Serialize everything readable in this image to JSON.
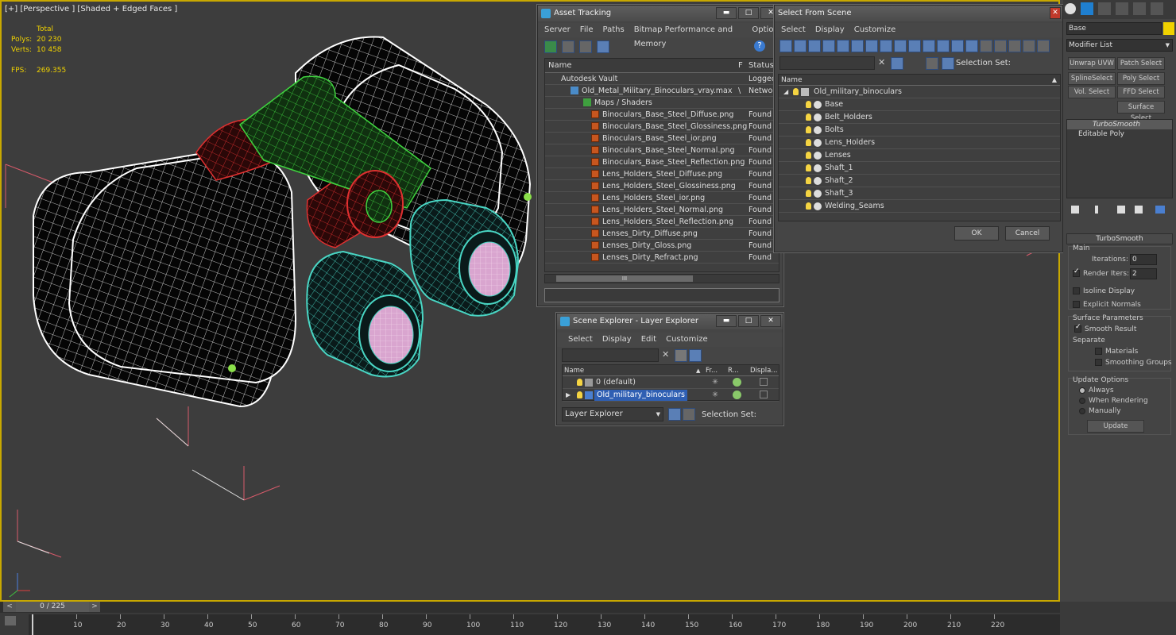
{
  "viewport": {
    "label": "[+] [Perspective ] [Shaded + Edged Faces ]",
    "stats": {
      "total_label": "Total",
      "polys_label": "Polys:",
      "polys": "20 230",
      "verts_label": "Verts:",
      "verts": "10 458",
      "fps_label": "FPS:",
      "fps": "269.355"
    }
  },
  "asset_tracking": {
    "title": "Asset Tracking",
    "menu": [
      "Server",
      "File",
      "Paths",
      "Bitmap Performance and Memory",
      "Options"
    ],
    "columns": {
      "name": "Name",
      "f": "F",
      "status": "Status"
    },
    "vault": {
      "name": "Autodesk Vault",
      "status": "Logged"
    },
    "scene_file": {
      "name": "Old_Metal_Military_Binoculars_vray.max",
      "f": "\\",
      "status": "Networ"
    },
    "maps_folder": "Maps / Shaders",
    "files": [
      {
        "name": "Binoculars_Base_Steel_Diffuse.png",
        "status": "Found"
      },
      {
        "name": "Binoculars_Base_Steel_Glossiness.png",
        "status": "Found"
      },
      {
        "name": "Binoculars_Base_Steel_ior.png",
        "status": "Found"
      },
      {
        "name": "Binoculars_Base_Steel_Normal.png",
        "status": "Found"
      },
      {
        "name": "Binoculars_Base_Steel_Reflection.png",
        "status": "Found"
      },
      {
        "name": "Lens_Holders_Steel_Diffuse.png",
        "status": "Found"
      },
      {
        "name": "Lens_Holders_Steel_Glossiness.png",
        "status": "Found"
      },
      {
        "name": "Lens_Holders_Steel_ior.png",
        "status": "Found"
      },
      {
        "name": "Lens_Holders_Steel_Normal.png",
        "status": "Found"
      },
      {
        "name": "Lens_Holders_Steel_Reflection.png",
        "status": "Found"
      },
      {
        "name": "Lenses_Dirty_Diffuse.png",
        "status": "Found"
      },
      {
        "name": "Lenses_Dirty_Gloss.png",
        "status": "Found"
      },
      {
        "name": "Lenses_Dirty_Refract.png",
        "status": "Found"
      }
    ],
    "scroll_mark": "III"
  },
  "select_from_scene": {
    "title": "Select From Scene",
    "menu": [
      "Select",
      "Display",
      "Customize"
    ],
    "selection_set_label": "Selection Set:",
    "column_name": "Name",
    "root": "Old_military_binoculars",
    "items": [
      "Base",
      "Belt_Holders",
      "Bolts",
      "Lens_Holders",
      "Lenses",
      "Shaft_1",
      "Shaft_2",
      "Shaft_3",
      "Welding_Seams"
    ],
    "ok": "OK",
    "cancel": "Cancel"
  },
  "scene_explorer": {
    "title": "Scene Explorer - Layer Explorer",
    "menu": [
      "Select",
      "Display",
      "Edit",
      "Customize"
    ],
    "columns": {
      "name": "Name",
      "fr": "Fr...",
      "r": "R...",
      "display": "Displa..."
    },
    "layers": [
      {
        "name": "0 (default)",
        "selected": false
      },
      {
        "name": "Old_military_binoculars",
        "selected": true
      }
    ],
    "explorer_type": "Layer Explorer",
    "selection_set_label": "Selection Set:"
  },
  "command_panel": {
    "object_name": "Base",
    "modifier_list": "Modifier List",
    "buttons": [
      "Unwrap UVW",
      "Patch Select",
      "SplineSelect",
      "Poly Select",
      "Vol. Select",
      "FFD Select",
      "Surface Select"
    ],
    "stack": [
      "TurboSmooth",
      "Editable Poly"
    ],
    "rollout_title": "TurboSmooth",
    "main_label": "Main",
    "iterations_label": "Iterations:",
    "iterations": "0",
    "render_iters_label": "Render Iters:",
    "render_iters": "2",
    "isoline": "Isoline Display",
    "explicit_normals": "Explicit Normals",
    "surface_params": "Surface Parameters",
    "smooth_result": "Smooth Result",
    "separate": "Separate",
    "materials": "Materials",
    "smoothing_groups": "Smoothing Groups",
    "update_options": "Update Options",
    "always": "Always",
    "when_rendering": "When Rendering",
    "manually": "Manually",
    "update_btn": "Update"
  },
  "timeline": {
    "frame": "0 / 225",
    "prev": "<",
    "next": ">",
    "ticks": [
      "10",
      "20",
      "30",
      "40",
      "50",
      "60",
      "70",
      "80",
      "90",
      "100",
      "110",
      "120",
      "130",
      "140",
      "150",
      "160",
      "170",
      "180",
      "190",
      "200",
      "210",
      "220"
    ]
  },
  "colors": {
    "viewport_border": "#c8a800",
    "wire": "#ffffff",
    "selected_green": "#3fd43f",
    "selected_red": "#e03030",
    "lens_cyan": "#49d6c4",
    "lens_pink": "#e8b8e0"
  }
}
